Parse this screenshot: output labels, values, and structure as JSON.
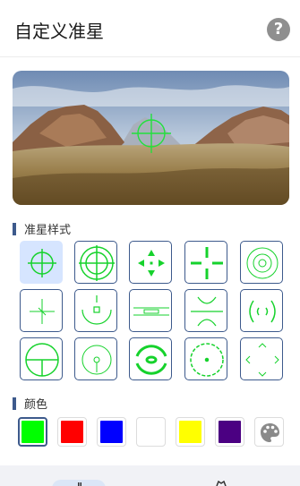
{
  "header": {
    "title": "自定义准星",
    "help_icon": "question-circle-icon"
  },
  "preview": {
    "image": "desert-landscape-with-green-crosshair",
    "crosshair_color": "#22e03c"
  },
  "sections": {
    "styles_title": "准星样式",
    "colors_title": "颜色"
  },
  "crosshair_styles": {
    "selected_index": 0,
    "items": [
      "circle-cross",
      "double-circle-cross",
      "arrow-cross",
      "gap-cross",
      "ring-dot",
      "thin-cross",
      "bracket-dot",
      "horizontal-line",
      "x-wings",
      "curly-brackets",
      "circle-lower-cross",
      "circle-dot",
      "thick-arcs",
      "dotted-circle",
      "corner-arrows"
    ]
  },
  "colors": {
    "selected_index": 0,
    "swatches": [
      "#00ff00",
      "#ff0000",
      "#0000ff",
      "#ffffff",
      "#ffff00",
      "#4b0082"
    ],
    "custom_icon": "palette-icon"
  },
  "bottom_nav": {
    "icons": [
      "crosshair-tab-icon",
      "settings-tab-icon"
    ]
  }
}
